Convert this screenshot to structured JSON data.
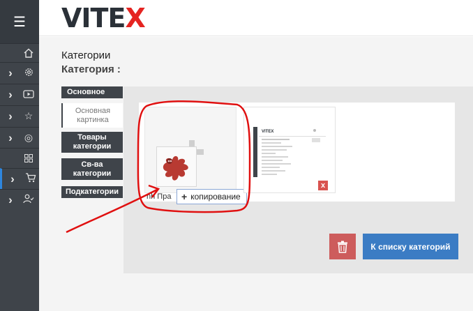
{
  "header": {
    "logo_text": "VITE",
    "logo_x": "X"
  },
  "page": {
    "title": "Категории",
    "subtitle": "Категория :"
  },
  "tabs": [
    {
      "label": "Основное"
    },
    {
      "label": "Основная картинка"
    },
    {
      "label": "Товары категории"
    },
    {
      "label": "Св-ва категории"
    },
    {
      "label": "Подкатегории"
    }
  ],
  "upload": {
    "file_name_fragment": "nh Пра",
    "tooltip_plus": "+",
    "tooltip_label": "копирование"
  },
  "preview": {
    "delete_glyph": "x",
    "mini_logo": "VITEX"
  },
  "buttons": {
    "back_to_list": "К списку категорий"
  },
  "sidebar": {
    "icons": [
      "home-icon",
      "gear-icon",
      "video-icon",
      "star-icon",
      "target-icon",
      "grid-icon",
      "cart-icon",
      "user-check-icon"
    ]
  },
  "colors": {
    "sidebar": "#3f444a",
    "brand_x": "#e52421",
    "primary_button": "#3b7cc4",
    "danger_button": "#cd5c5c",
    "annotation": "#e01010"
  }
}
